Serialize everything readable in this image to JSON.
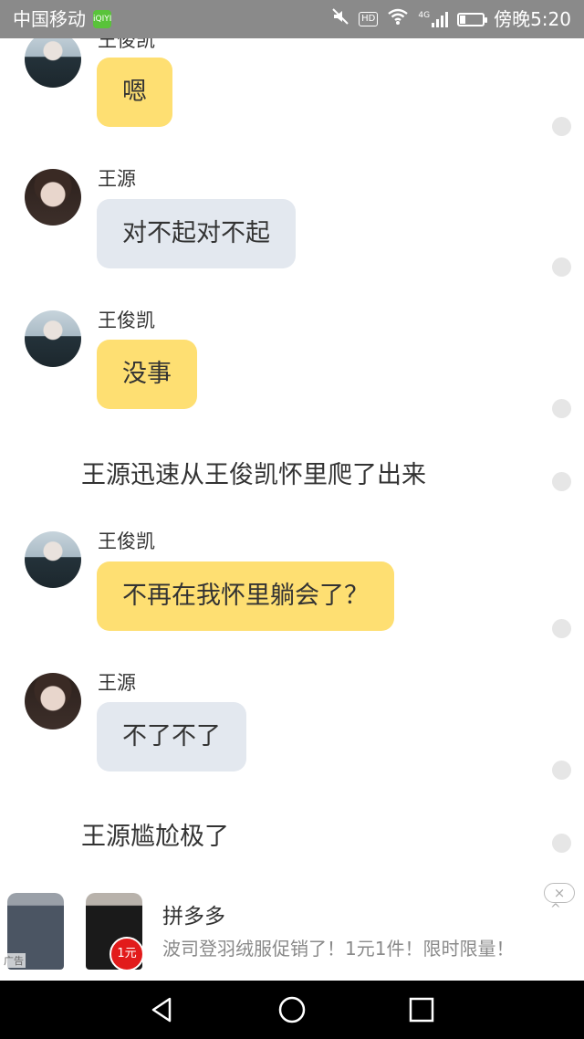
{
  "status_bar": {
    "carrier": "中国移动",
    "carrier_badge": "iQIYI",
    "hd_badge": "HD",
    "network_label": "4G",
    "time": "傍晚5:20",
    "battery_level": 0.25,
    "icons": [
      "mute-icon",
      "wifi-icon",
      "signal-icon",
      "battery-icon"
    ]
  },
  "messages": [
    {
      "type": "msg",
      "speaker": "王俊凯",
      "avatar": "wjk",
      "text": "嗯",
      "bubble_color": "#fedf72"
    },
    {
      "type": "msg",
      "speaker": "王源",
      "avatar": "wy",
      "text": "对不起对不起",
      "bubble_color": "#e3e8ef"
    },
    {
      "type": "msg",
      "speaker": "王俊凯",
      "avatar": "wjk",
      "text": "没事",
      "bubble_color": "#fedf72"
    },
    {
      "type": "narration",
      "text": "王源迅速从王俊凯怀里爬了出来"
    },
    {
      "type": "msg",
      "speaker": "王俊凯",
      "avatar": "wjk",
      "text": "不再在我怀里躺会了？",
      "bubble_color": "#fedf72"
    },
    {
      "type": "msg",
      "speaker": "王源",
      "avatar": "wy",
      "text": "不了不了",
      "bubble_color": "#e3e8ef"
    },
    {
      "type": "narration",
      "text": "王源尴尬极了"
    }
  ],
  "ad": {
    "tag": "广告",
    "price_badge": "1元",
    "title": "拼多多",
    "description": "波司登羽绒服促销了！1元1件！限时限量！",
    "close_glyph": "×",
    "collapse_glyph": "^"
  },
  "nav": {
    "icons": [
      "back-icon",
      "home-icon",
      "recent-apps-icon"
    ]
  }
}
